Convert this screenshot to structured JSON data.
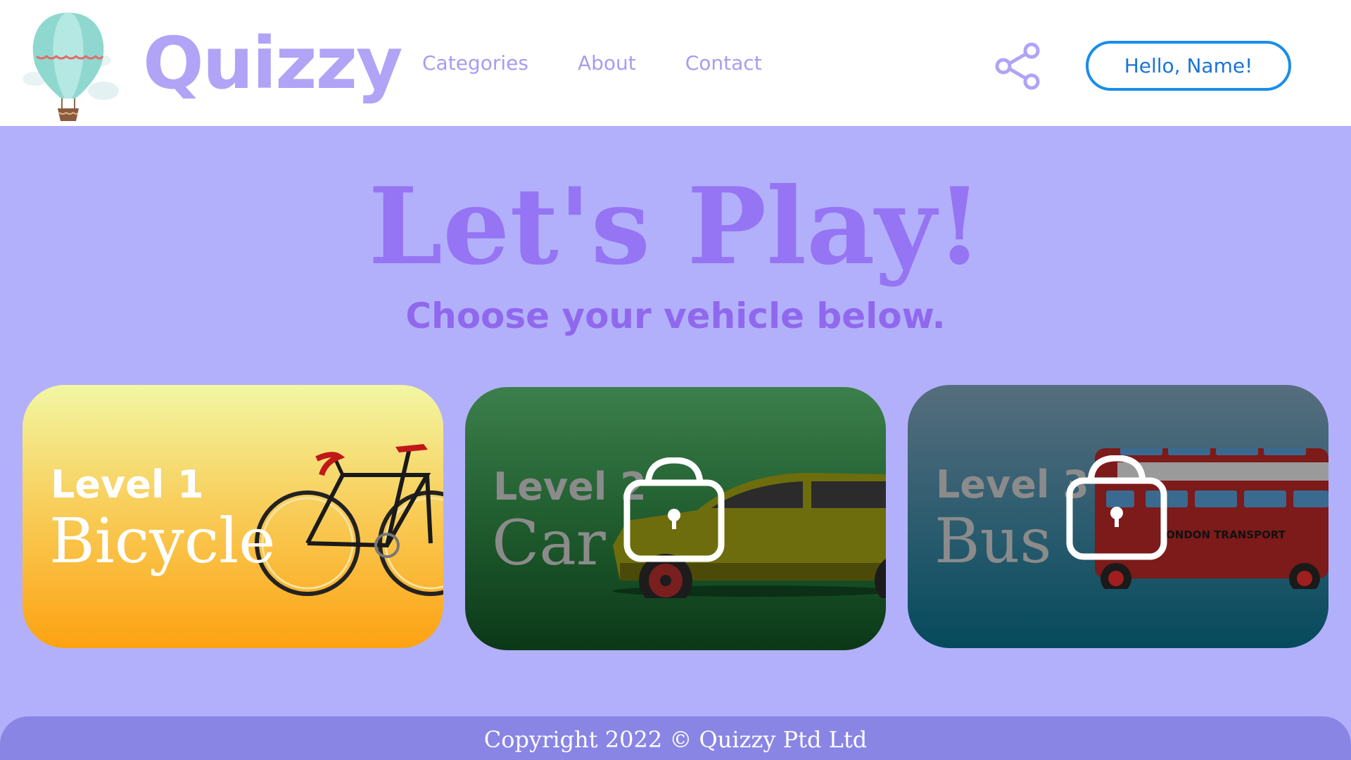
{
  "header": {
    "brand": "Quizzy",
    "logo_icon": "hot-air-balloon-icon",
    "nav": [
      {
        "label": "Categories"
      },
      {
        "label": "About"
      },
      {
        "label": "Contact"
      }
    ],
    "share_icon": "share-icon",
    "greeting_button": "Hello, Name!"
  },
  "hero": {
    "title": "Let's Play!",
    "subtitle": "Choose your vehicle below."
  },
  "cards": [
    {
      "level": "Level 1",
      "name": "Bicycle",
      "locked": false,
      "icon": "bicycle-icon"
    },
    {
      "level": "Level 2",
      "name": "Car",
      "locked": true,
      "icon": "car-icon"
    },
    {
      "level": "Level 3",
      "name": "Bus",
      "locked": true,
      "icon": "bus-icon",
      "bus_sign": "LONDON TRANSPORT"
    }
  ],
  "footer": {
    "copyright": "Copyright 2022 © Quizzy Ptd Ltd"
  },
  "colors": {
    "primary": "#9575f3",
    "header_bg": "#ffffff",
    "page_bg": "#b3b0fb",
    "footer_bg": "#8985e5",
    "button_border": "#1a8de8"
  }
}
